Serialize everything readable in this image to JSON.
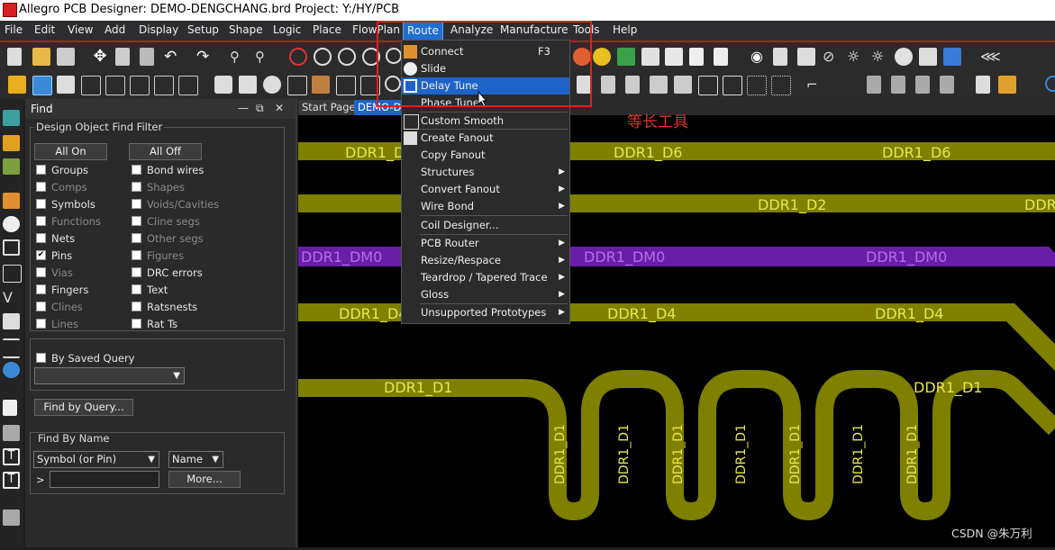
{
  "window": {
    "title": "Allegro PCB Designer: DEMO-DENGCHANG.brd  Project: Y:/HY/PCB"
  },
  "menubar": {
    "items": [
      "File",
      "Edit",
      "View",
      "Add",
      "Display",
      "Setup",
      "Shape",
      "Logic",
      "Place",
      "FlowPlan",
      "Route",
      "Analyze",
      "Manufacture",
      "Tools",
      "Help"
    ],
    "active": "Route"
  },
  "route_menu": {
    "items": [
      {
        "label": "Connect",
        "shortcut": "F3",
        "icon": "connect-icon"
      },
      {
        "label": "Slide",
        "icon": "slide-icon"
      },
      {
        "label": "Delay Tune",
        "icon": "delay-tune-icon",
        "highlighted": true
      },
      {
        "label": "Phase Tune",
        "icon": ""
      },
      {
        "label": "Custom Smooth",
        "icon": "custom-smooth-icon"
      },
      {
        "label": "Create Fanout",
        "icon": "fanout-icon"
      },
      {
        "label": "Copy Fanout",
        "icon": ""
      },
      {
        "label": "Structures",
        "submenu": true
      },
      {
        "label": "Convert Fanout",
        "submenu": true
      },
      {
        "label": "Wire Bond",
        "submenu": true
      },
      {
        "label": "Coil Designer...",
        "icon": ""
      },
      {
        "label": "PCB Router",
        "submenu": true
      },
      {
        "label": "Resize/Respace",
        "submenu": true
      },
      {
        "label": "Teardrop / Tapered Trace",
        "submenu": true
      },
      {
        "label": "Gloss",
        "submenu": true
      },
      {
        "label": "Unsupported Prototypes",
        "submenu": true
      }
    ]
  },
  "find_panel": {
    "title": "Find",
    "filter_group_label": "Design Object Find Filter",
    "all_on": "All On",
    "all_off": "All Off",
    "col1": [
      {
        "label": "Groups",
        "checked": false,
        "enabled": true
      },
      {
        "label": "Comps",
        "checked": false,
        "enabled": false
      },
      {
        "label": "Symbols",
        "checked": false,
        "enabled": true
      },
      {
        "label": "Functions",
        "checked": false,
        "enabled": false
      },
      {
        "label": "Nets",
        "checked": false,
        "enabled": true
      },
      {
        "label": "Pins",
        "checked": true,
        "enabled": true
      },
      {
        "label": "Vias",
        "checked": false,
        "enabled": false
      },
      {
        "label": "Fingers",
        "checked": false,
        "enabled": true
      },
      {
        "label": "Clines",
        "checked": false,
        "enabled": false
      },
      {
        "label": "Lines",
        "checked": false,
        "enabled": false
      }
    ],
    "col2": [
      {
        "label": "Bond wires",
        "checked": false,
        "enabled": true
      },
      {
        "label": "Shapes",
        "checked": false,
        "enabled": false
      },
      {
        "label": "Voids/Cavities",
        "checked": false,
        "enabled": false
      },
      {
        "label": "Cline segs",
        "checked": false,
        "enabled": false
      },
      {
        "label": "Other segs",
        "checked": false,
        "enabled": false
      },
      {
        "label": "Figures",
        "checked": false,
        "enabled": false
      },
      {
        "label": "DRC errors",
        "checked": false,
        "enabled": true
      },
      {
        "label": "Text",
        "checked": false,
        "enabled": true
      },
      {
        "label": "Ratsnests",
        "checked": false,
        "enabled": true
      },
      {
        "label": "Rat Ts",
        "checked": false,
        "enabled": true
      }
    ],
    "by_saved_query": "By Saved Query",
    "find_by_query": "Find by Query...",
    "find_by_name_label": "Find By Name",
    "name_type": "Symbol (or Pin)",
    "name_mode": "Name",
    "prompt": ">",
    "more": "More..."
  },
  "tabs": [
    "Start Page",
    "DEMO-D"
  ],
  "canvas": {
    "nets": [
      "DDR1_D6",
      "DDR1_D2",
      "DDR1_DM0",
      "DDR1_D4",
      "DDR1_D1"
    ],
    "trace_colors": {
      "data": "#7f7f00",
      "dm": "#6a1ea8",
      "label_data": "#e8e84a",
      "label_dm": "#b070e8"
    }
  },
  "annotation": "等长工具",
  "watermark": "CSDN @朱万利",
  "colors": {
    "accent": "#1e64c8",
    "annot_red": "#e02020"
  }
}
